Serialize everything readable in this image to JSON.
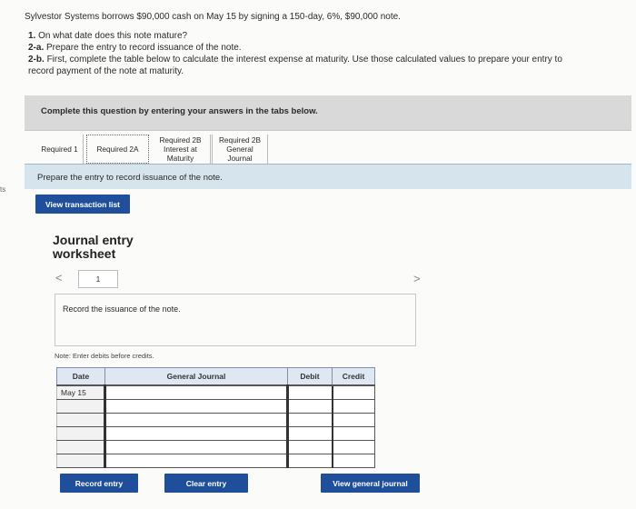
{
  "problem": {
    "statement": "Sylvestor Systems borrows $90,000 cash on May 15 by signing a 150-day, 6%, $90,000 note.",
    "q1_num": "1.",
    "q1_text": "On what date does this note mature?",
    "q2a_num": "2-a.",
    "q2a_text": "Prepare the entry to record issuance of the note.",
    "q2b_num": "2-b.",
    "q2b_text_line1": "First, complete the table below to calculate the interest expense at maturity. Use those calculated values to prepare your entry to",
    "q2b_text_line2": "record payment of the note at maturity."
  },
  "edge_mark": "ts",
  "panel": {
    "header": "Complete this question by entering your answers in the tabs below."
  },
  "tabs": [
    {
      "line1": "Required 1",
      "line2": "",
      "line3": ""
    },
    {
      "line1": "Required 2A",
      "line2": "",
      "line3": ""
    },
    {
      "line1": "Required 2B",
      "line2": "Interest at",
      "line3": "Maturity"
    },
    {
      "line1": "Required 2B",
      "line2": "General",
      "line3": "Journal"
    }
  ],
  "prompt": "Prepare the entry to record issuance of the note.",
  "buttons": {
    "view_transactions": "View transaction list",
    "record_entry": "Record entry",
    "clear_entry": "Clear entry",
    "view_general_journal": "View general journal"
  },
  "worksheet": {
    "title_line1": "Journal entry",
    "title_line2": "worksheet",
    "prev_arrow": "<",
    "next_arrow": ">",
    "page_number": "1",
    "instruction": "Record the issuance of the note.",
    "note": "Note: Enter debits before credits."
  },
  "journal": {
    "columns": {
      "date": "Date",
      "general_journal": "General Journal",
      "debit": "Debit",
      "credit": "Credit"
    },
    "rows": [
      {
        "date": "May 15",
        "account": "",
        "debit": "",
        "credit": ""
      },
      {
        "date": "",
        "account": "",
        "debit": "",
        "credit": ""
      },
      {
        "date": "",
        "account": "",
        "debit": "",
        "credit": ""
      },
      {
        "date": "",
        "account": "",
        "debit": "",
        "credit": ""
      },
      {
        "date": "",
        "account": "",
        "debit": "",
        "credit": ""
      },
      {
        "date": "",
        "account": "",
        "debit": "",
        "credit": ""
      }
    ]
  },
  "colors": {
    "button_blue": "#1f4f9b",
    "prompt_bar": "#d5e4ed",
    "panel_header": "#d9d9d9",
    "table_header": "#dfe8f2"
  }
}
